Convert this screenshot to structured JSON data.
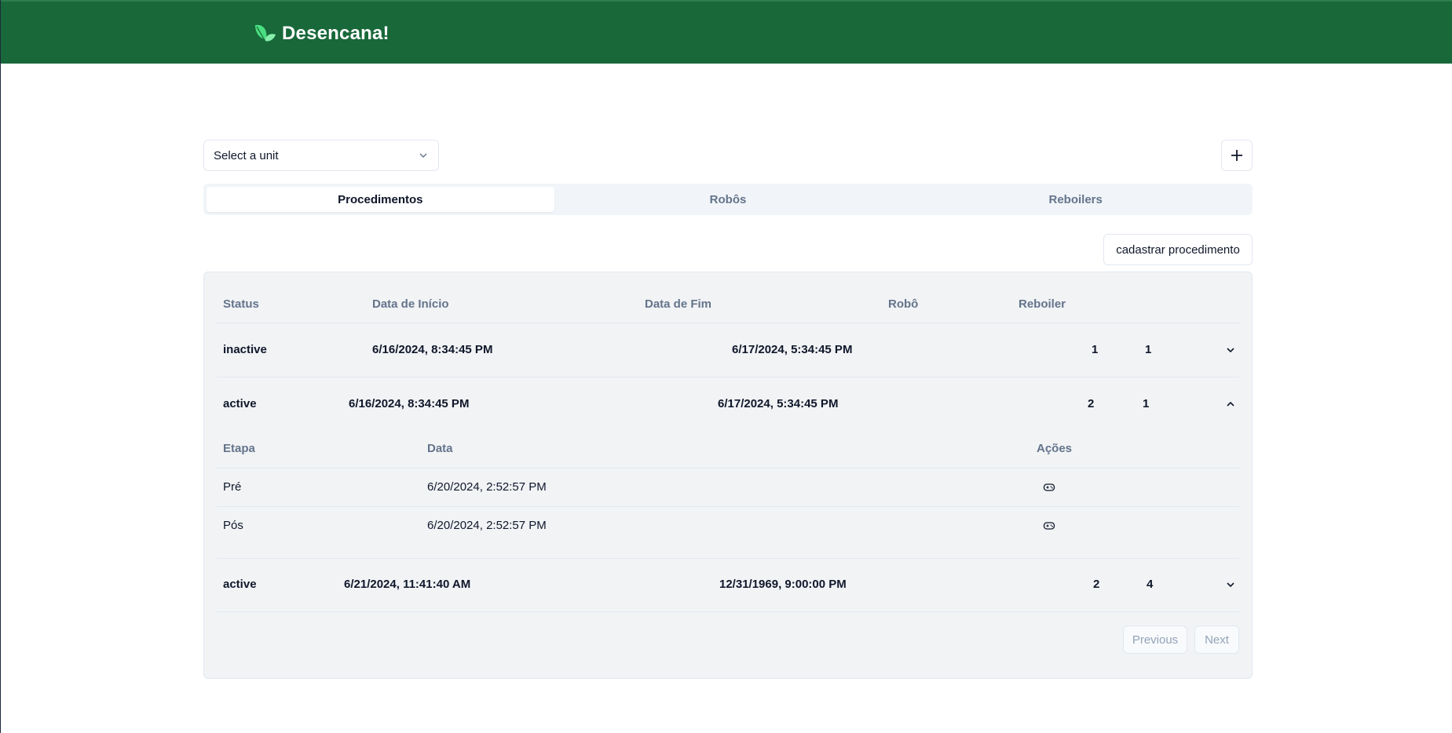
{
  "app": {
    "name": "Desencana!"
  },
  "unit_select": {
    "placeholder": "Select a unit"
  },
  "tabs": [
    {
      "label": "Procedimentos",
      "active": true
    },
    {
      "label": "Robôs",
      "active": false
    },
    {
      "label": "Reboilers",
      "active": false
    }
  ],
  "register_label": "cadastrar procedimento",
  "table": {
    "headers": {
      "status": "Status",
      "start": "Data de Início",
      "end": "Data de Fim",
      "robot": "Robô",
      "reboiler": "Reboiler"
    },
    "rows": [
      {
        "status": "inactive",
        "start": "6/16/2024, 8:34:45 PM",
        "end": "6/17/2024, 5:34:45 PM",
        "robot": "1",
        "reboiler": "1",
        "expanded": false
      },
      {
        "status": "active",
        "start": "6/16/2024, 8:34:45 PM",
        "end": "6/17/2024, 5:34:45 PM",
        "robot": "2",
        "reboiler": "1",
        "expanded": true
      },
      {
        "status": "active",
        "start": "6/21/2024, 11:41:40 AM",
        "end": "12/31/1969, 9:00:00 PM",
        "robot": "2",
        "reboiler": "4",
        "expanded": false
      }
    ],
    "subtable": {
      "headers": {
        "stage": "Etapa",
        "date": "Data",
        "actions": "Ações"
      },
      "rows": [
        {
          "stage": "Pré",
          "date": "6/20/2024, 2:52:57 PM",
          "action_icon": "gamepad-icon"
        },
        {
          "stage": "Pós",
          "date": "6/20/2024, 2:52:57 PM",
          "action_icon": "gamepad-icon"
        }
      ]
    }
  },
  "pagination": {
    "previous": "Previous",
    "next": "Next"
  },
  "colors": {
    "header_bg": "#18683a",
    "panel_bg": "#f1f3f5",
    "muted_text": "#64748b"
  }
}
